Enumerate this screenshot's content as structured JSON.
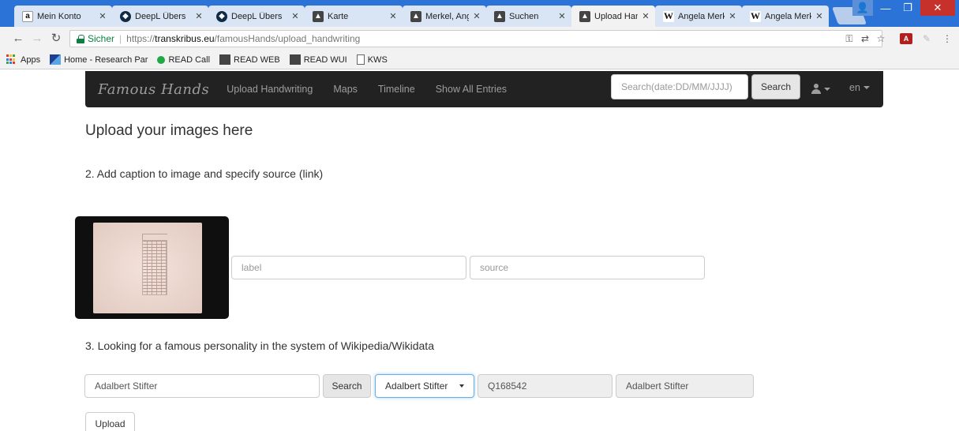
{
  "browser": {
    "tabs": [
      {
        "title": "Mein Konto",
        "icon": "amazon-icon"
      },
      {
        "title": "DeepL Übers",
        "icon": "deepl-icon"
      },
      {
        "title": "DeepL Übers",
        "icon": "deepl-icon"
      },
      {
        "title": "Karte",
        "icon": "transkribus-icon"
      },
      {
        "title": "Merkel, Ange",
        "icon": "transkribus-icon"
      },
      {
        "title": "Suchen",
        "icon": "transkribus-icon"
      },
      {
        "title": "Upload Hand",
        "icon": "transkribus-icon",
        "active": true
      },
      {
        "title": "Angela Merk",
        "icon": "wikipedia-icon"
      },
      {
        "title": "Angela Merk",
        "icon": "wikipedia-icon"
      }
    ],
    "address": {
      "secure_label": "Sicher",
      "url_scheme": "https://",
      "url_host": "transkribus.eu",
      "url_path": "/famousHands/upload_handwriting"
    },
    "bookmarks": [
      {
        "label": "Apps",
        "icon": "apps-grid-icon"
      },
      {
        "label": "Home - Research Par",
        "icon": "home-research-icon"
      },
      {
        "label": "READ Call",
        "icon": "read-call-icon"
      },
      {
        "label": "READ WEB",
        "icon": "transkribus-icon"
      },
      {
        "label": "READ WUI",
        "icon": "transkribus-icon"
      },
      {
        "label": "KWS",
        "icon": "document-icon"
      }
    ]
  },
  "navbar": {
    "brand": "Famous Hands",
    "links": [
      "Upload Handwriting",
      "Maps",
      "Timeline",
      "Show All Entries"
    ],
    "search_placeholder": "Search(date:DD/MM/JJJJ)",
    "search_button": "Search",
    "language": "en"
  },
  "page": {
    "title": "Upload your images here",
    "step2_heading": "2. Add caption to image and specify source (link)",
    "label_placeholder": "label",
    "source_placeholder": "source",
    "step3_heading": "3. Looking for a famous personality in the system of Wikipedia/Wikidata",
    "person_query": "Adalbert Stifter",
    "person_search_button": "Search",
    "person_select_value": "Adalbert Stifter",
    "wikidata_id": "Q168542",
    "person_name_readonly": "Adalbert Stifter",
    "upload_button": "Upload"
  },
  "colors": {
    "tabstrip": "#2b73d6",
    "navbar": "#222222",
    "secure": "#0b8043",
    "focus": "#66afe9"
  }
}
